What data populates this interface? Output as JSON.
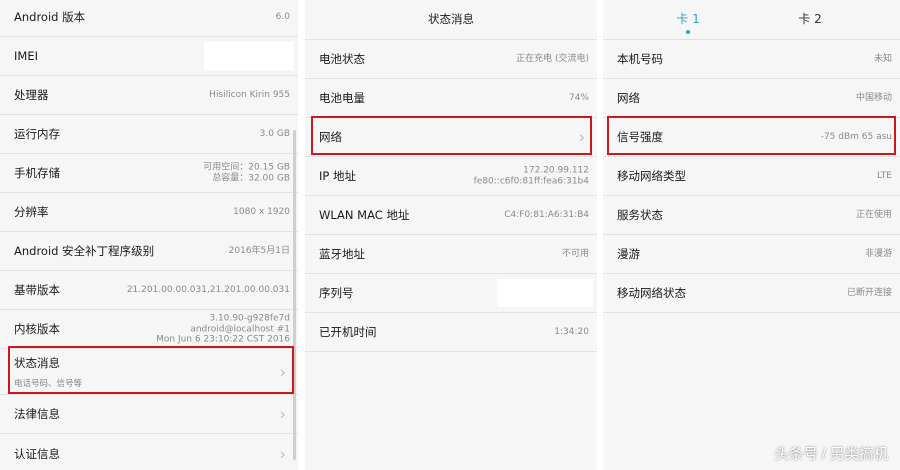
{
  "panel_about": {
    "rows": [
      {
        "label": "Android 版本",
        "value": "6.0"
      },
      {
        "label": "IMEI",
        "value": ""
      },
      {
        "label": "处理器",
        "value": "Hisilicon Kirin 955"
      },
      {
        "label": "运行内存",
        "value": "3.0 GB"
      },
      {
        "label": "手机存储",
        "value": "可用空间：20.15  GB",
        "value2": "总容量：32.00  GB"
      },
      {
        "label": "分辨率",
        "value": "1080 x 1920"
      },
      {
        "label": "Android 安全补丁程序级别",
        "value": "2016年5月1日"
      },
      {
        "label": "基带版本",
        "value": "21.201.00.00.031,21.201.00.00.031"
      },
      {
        "label": "内核版本",
        "value": "3.10.90-g928fe7d",
        "value2": "android@localhost #1",
        "value3": "Mon Jun 6 23:10:22 CST 2016"
      },
      {
        "label": "状态消息",
        "sub": "电话号码、信号等"
      },
      {
        "label": "法律信息"
      },
      {
        "label": "认证信息"
      }
    ],
    "chevron": "›"
  },
  "panel_status": {
    "title": "状态消息",
    "rows": [
      {
        "label": "电池状态",
        "value": "正在充电 (交流电)"
      },
      {
        "label": "电池电量",
        "value": "74%"
      },
      {
        "label": "网络"
      },
      {
        "label": "IP 地址",
        "value": "172.20.99.112",
        "value2": "fe80::c6f0:81ff:fea6:31b4"
      },
      {
        "label": "WLAN MAC 地址",
        "value": "C4:F0:81:A6:31:B4"
      },
      {
        "label": "蓝牙地址",
        "value": "不可用"
      },
      {
        "label": "序列号",
        "value": ""
      },
      {
        "label": "已开机时间",
        "value": "1:34:20"
      }
    ]
  },
  "panel_sim": {
    "tabs": [
      "卡 1",
      "卡 2"
    ],
    "rows": [
      {
        "label": "本机号码",
        "value": "未知"
      },
      {
        "label": "网络",
        "value": "中国移动"
      },
      {
        "label": "信号强度",
        "value": "-75 dBm   65 asu"
      },
      {
        "label": "移动网络类型",
        "value": "LTE"
      },
      {
        "label": "服务状态",
        "value": "正在使用"
      },
      {
        "label": "漫游",
        "value": "非漫游"
      },
      {
        "label": "移动网络状态",
        "value": "已断开连接"
      }
    ]
  },
  "watermark": "头条号 / 另类搞机",
  "colors": {
    "highlight": "#cc1620",
    "tab_active": "#2aa3c9",
    "panel_bg": "#f6f6f6"
  }
}
